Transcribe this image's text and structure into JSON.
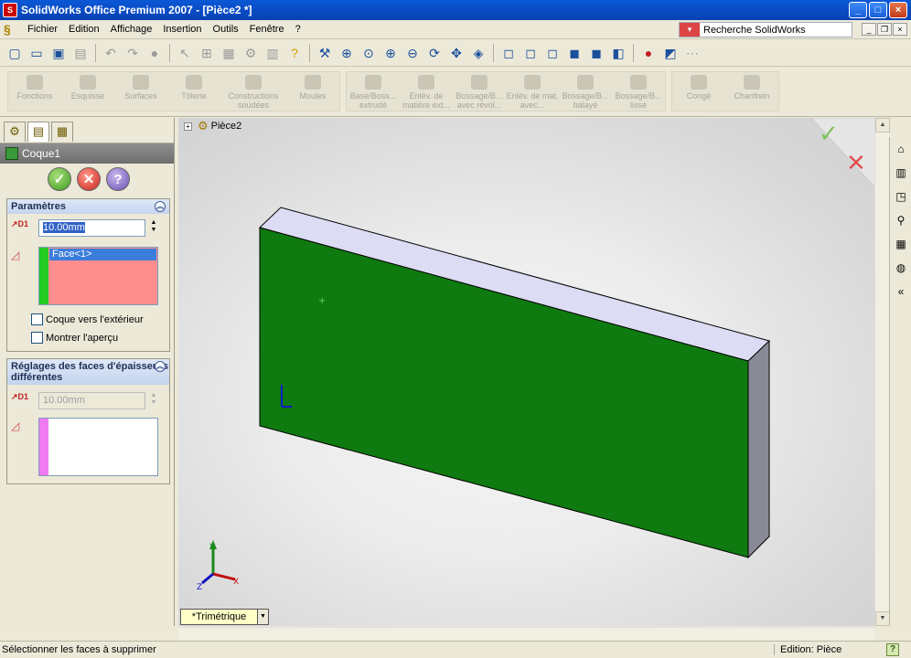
{
  "window": {
    "title": "SolidWorks Office Premium 2007 - [Pièce2 *]"
  },
  "menu": {
    "items": [
      "Fichier",
      "Edition",
      "Affichage",
      "Insertion",
      "Outils",
      "Fenêtre",
      "?"
    ],
    "search_placeholder": "Recherche SolidWorks"
  },
  "command_manager": {
    "groups": [
      [
        "Fonctions",
        "Esquisse",
        "Surfaces",
        "Tôlerie",
        "Constructions soudées",
        "Moules"
      ],
      [
        "Base/Boss... extrudé",
        "Enlèv. de matière ext...",
        "Bossage/B... avec révol...",
        "Enlèv. de mat. avec...",
        "Bossage/B... balayé",
        "Bossage/B... lissé"
      ],
      [
        "Congé",
        "Chanfrein"
      ]
    ]
  },
  "property_manager": {
    "title": "Coque1",
    "parametres": {
      "label": "Paramètres",
      "thickness": "10.00mm",
      "selected_face": "Face<1>",
      "shell_outward_label": "Coque vers l'extérieur",
      "shell_outward_checked": false,
      "show_preview_label": "Montrer l'aperçu",
      "show_preview_checked": false
    },
    "multi_thickness": {
      "label": "Réglages des faces d'épaisseurs différentes",
      "thickness": "10.00mm"
    }
  },
  "graphics": {
    "tree_root": "Pièce2",
    "view_orientation": "*Trimétrique",
    "part_color": "#0f7a0f"
  },
  "status": {
    "message": "Sélectionner les faces à supprimer",
    "mode": "Edition: Pièce"
  },
  "colors": {
    "accent": "#0a58d6",
    "selection": "#3b7ddb",
    "face_list_bg": "#fe8e8e",
    "face_stripe": "#22cc22",
    "multi_stripe": "#f07af0"
  }
}
